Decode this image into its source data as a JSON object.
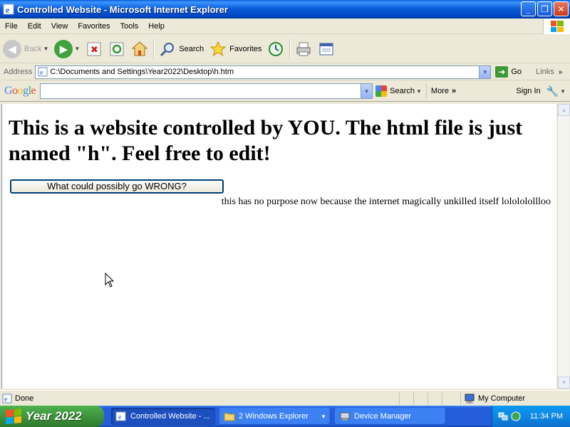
{
  "window": {
    "title": "Controlled Website - Microsoft Internet Explorer"
  },
  "menu": [
    "File",
    "Edit",
    "View",
    "Favorites",
    "Tools",
    "Help"
  ],
  "toolbar": {
    "back_label": "Back",
    "search_label": "Search",
    "favorites_label": "Favorites"
  },
  "address": {
    "label": "Address",
    "url": "C:\\Documents and Settings\\Year2022\\Desktop\\h.htm",
    "go_label": "Go",
    "links_label": "Links"
  },
  "google_toolbar": {
    "logo": "Google",
    "search_value": "",
    "search_label": "Search",
    "more_label": "More",
    "signin_label": "Sign In"
  },
  "page": {
    "heading": "This is a website controlled by YOU. The html file is just named \"h\". Feel free to edit!",
    "button_label": "What could possibly go WRONG?",
    "note": "this has no purpose now because the internet magically unkilled itself lolololollloo"
  },
  "status": {
    "text": "Done",
    "zone": "My Computer"
  },
  "taskbar": {
    "start_label": "Year 2022",
    "tasks": [
      "Controlled Website - ...",
      "2 Windows Explorer",
      "Device Manager"
    ],
    "clock": "11:34 PM"
  },
  "colors": {
    "title_bar": "#0a5fd8",
    "taskbar": "#245edb",
    "start_button": "#3c8f3c",
    "tray": "#0f83e0"
  }
}
